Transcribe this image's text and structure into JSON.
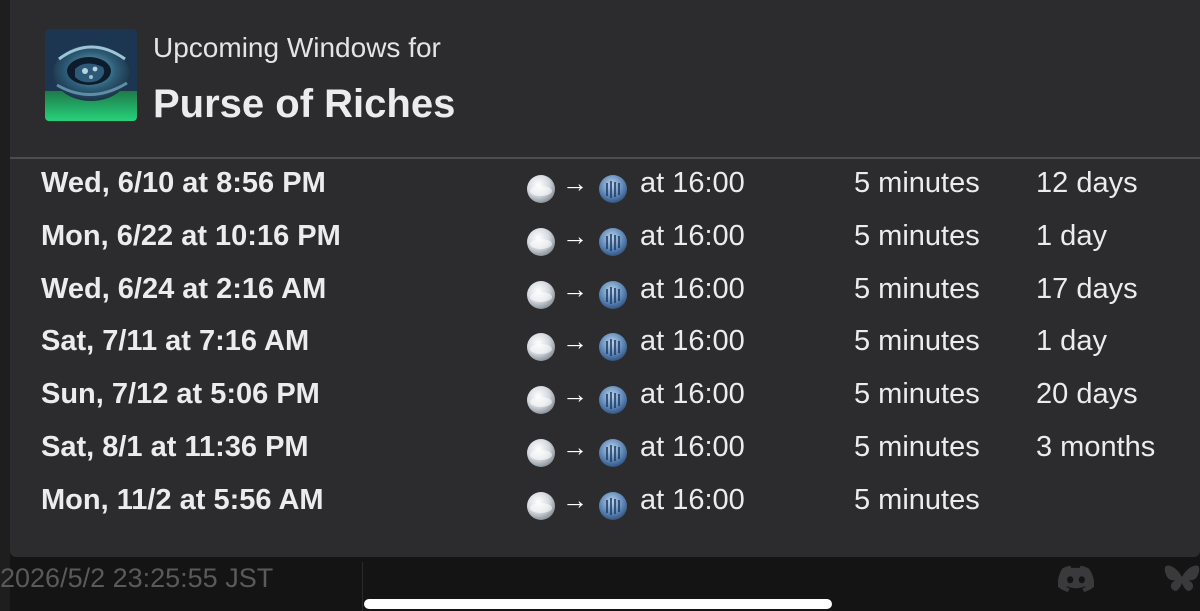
{
  "header": {
    "subtitle": "Upcoming Windows for",
    "title": "Purse of Riches",
    "icon": "purse-of-riches-item-icon"
  },
  "weather_icons": {
    "from": "fair-skies-icon",
    "arrow": "→",
    "to": "rain-icon"
  },
  "windows": [
    {
      "date": "Wed, 6/10 at 8:56 PM",
      "time": "at 16:00",
      "duration": "5 minutes",
      "next": "12 days"
    },
    {
      "date": "Mon, 6/22 at 10:16 PM",
      "time": "at 16:00",
      "duration": "5 minutes",
      "next": "1 day"
    },
    {
      "date": "Wed, 6/24 at 2:16 AM",
      "time": "at 16:00",
      "duration": "5 minutes",
      "next": "17 days"
    },
    {
      "date": "Sat, 7/11 at 7:16 AM",
      "time": "at 16:00",
      "duration": "5 minutes",
      "next": "1 day"
    },
    {
      "date": "Sun, 7/12 at 5:06 PM",
      "time": "at 16:00",
      "duration": "5 minutes",
      "next": "20 days"
    },
    {
      "date": "Sat, 8/1 at 11:36 PM",
      "time": "at 16:00",
      "duration": "5 minutes",
      "next": "3 months"
    },
    {
      "date": "Mon, 11/2 at 5:56 AM",
      "time": "at 16:00",
      "duration": "5 minutes",
      "next": ""
    }
  ],
  "footer": {
    "timestamp": "2026/5/2 23:25:55 JST",
    "icons": [
      "discord-icon",
      "butterfly-icon"
    ]
  },
  "colors": {
    "card_background": "#2c2c2e",
    "page_background": "#141414",
    "text": "#ececee",
    "timestamp_text": "#5a5a5c",
    "divider": "#4d4d50"
  }
}
